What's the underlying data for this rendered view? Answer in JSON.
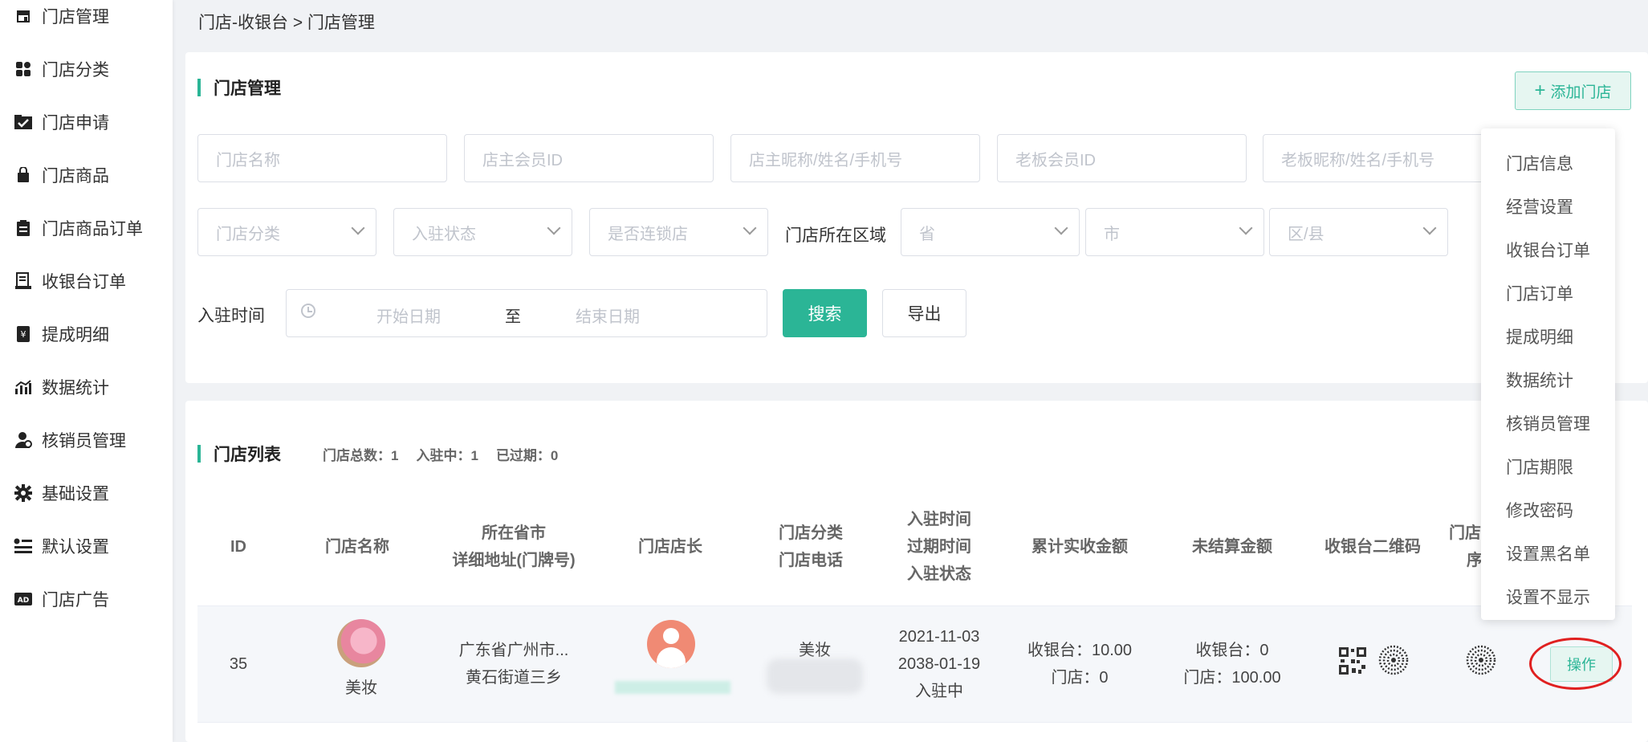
{
  "sidebar": {
    "items": [
      {
        "label": "门店管理",
        "icon": "store-icon"
      },
      {
        "label": "门店分类",
        "icon": "category-icon"
      },
      {
        "label": "门店申请",
        "icon": "application-icon"
      },
      {
        "label": "门店商品",
        "icon": "bag-icon"
      },
      {
        "label": "门店商品订单",
        "icon": "order-icon"
      },
      {
        "label": "收银台订单",
        "icon": "cashier-icon"
      },
      {
        "label": "提成明细",
        "icon": "commission-icon"
      },
      {
        "label": "数据统计",
        "icon": "chart-icon"
      },
      {
        "label": "核销员管理",
        "icon": "user-icon"
      },
      {
        "label": "基础设置",
        "icon": "gear-icon"
      },
      {
        "label": "默认设置",
        "icon": "settings-list-icon"
      },
      {
        "label": "门店广告",
        "icon": "ad-icon"
      }
    ]
  },
  "breadcrumb": "门店-收银台 > 门店管理",
  "filter_card": {
    "title": "门店管理",
    "add_button": "添加门店",
    "inputs": {
      "store_name": "门店名称",
      "owner_member_id": "店主会员ID",
      "owner_nick": "店主昵称/姓名/手机号",
      "boss_member_id": "老板会员ID",
      "boss_nick": "老板昵称/姓名/手机号"
    },
    "selects": {
      "category": "门店分类",
      "status": "入驻状态",
      "chain": "是否连锁店",
      "province": "省",
      "city": "市",
      "district": "区/县"
    },
    "region_label": "门店所在区域",
    "join_time_label": "入驻时间",
    "date_start": "开始日期",
    "date_to": "至",
    "date_end": "结束日期",
    "search_button": "搜索",
    "export_button": "导出"
  },
  "list_card": {
    "title": "门店列表",
    "stats": {
      "total": "门店总数：1",
      "active": "入驻中：1",
      "expired": "已过期：0"
    },
    "headers": {
      "id": "ID",
      "name": "门店名称",
      "address_1": "所在省市",
      "address_2": "详细地址(门牌号)",
      "owner": "门店店长",
      "cat_1": "门店分类",
      "cat_2": "门店电话",
      "time_1": "入驻时间",
      "time_2": "过期时间",
      "time_3": "入驻状态",
      "total_amount": "累计实收金额",
      "unsettled": "未结算金额",
      "qrcode": "收银台二维码",
      "partial_1": "门店",
      "partial_2": "序"
    },
    "row": {
      "id": "35",
      "name": "美妆",
      "region": "广东省广州市...",
      "address": "黄石街道三乡",
      "category": "美妆",
      "join_date": "2021-11-03",
      "expire_date": "2038-01-19",
      "status": "入驻中",
      "total_cashier": "收银台：10.00",
      "total_store": "门店：0",
      "unsettled_cashier": "收银台：0",
      "unsettled_store": "门店：100.00",
      "action": "操作"
    }
  },
  "popup_menu": {
    "items": [
      "门店信息",
      "经营设置",
      "收银台订单",
      "门店订单",
      "提成明细",
      "数据统计",
      "核销员管理",
      "门店期限",
      "修改密码",
      "设置黑名单",
      "设置不显示"
    ]
  },
  "colors": {
    "accent": "#2bb596",
    "highlight_ring": "#e02020"
  }
}
